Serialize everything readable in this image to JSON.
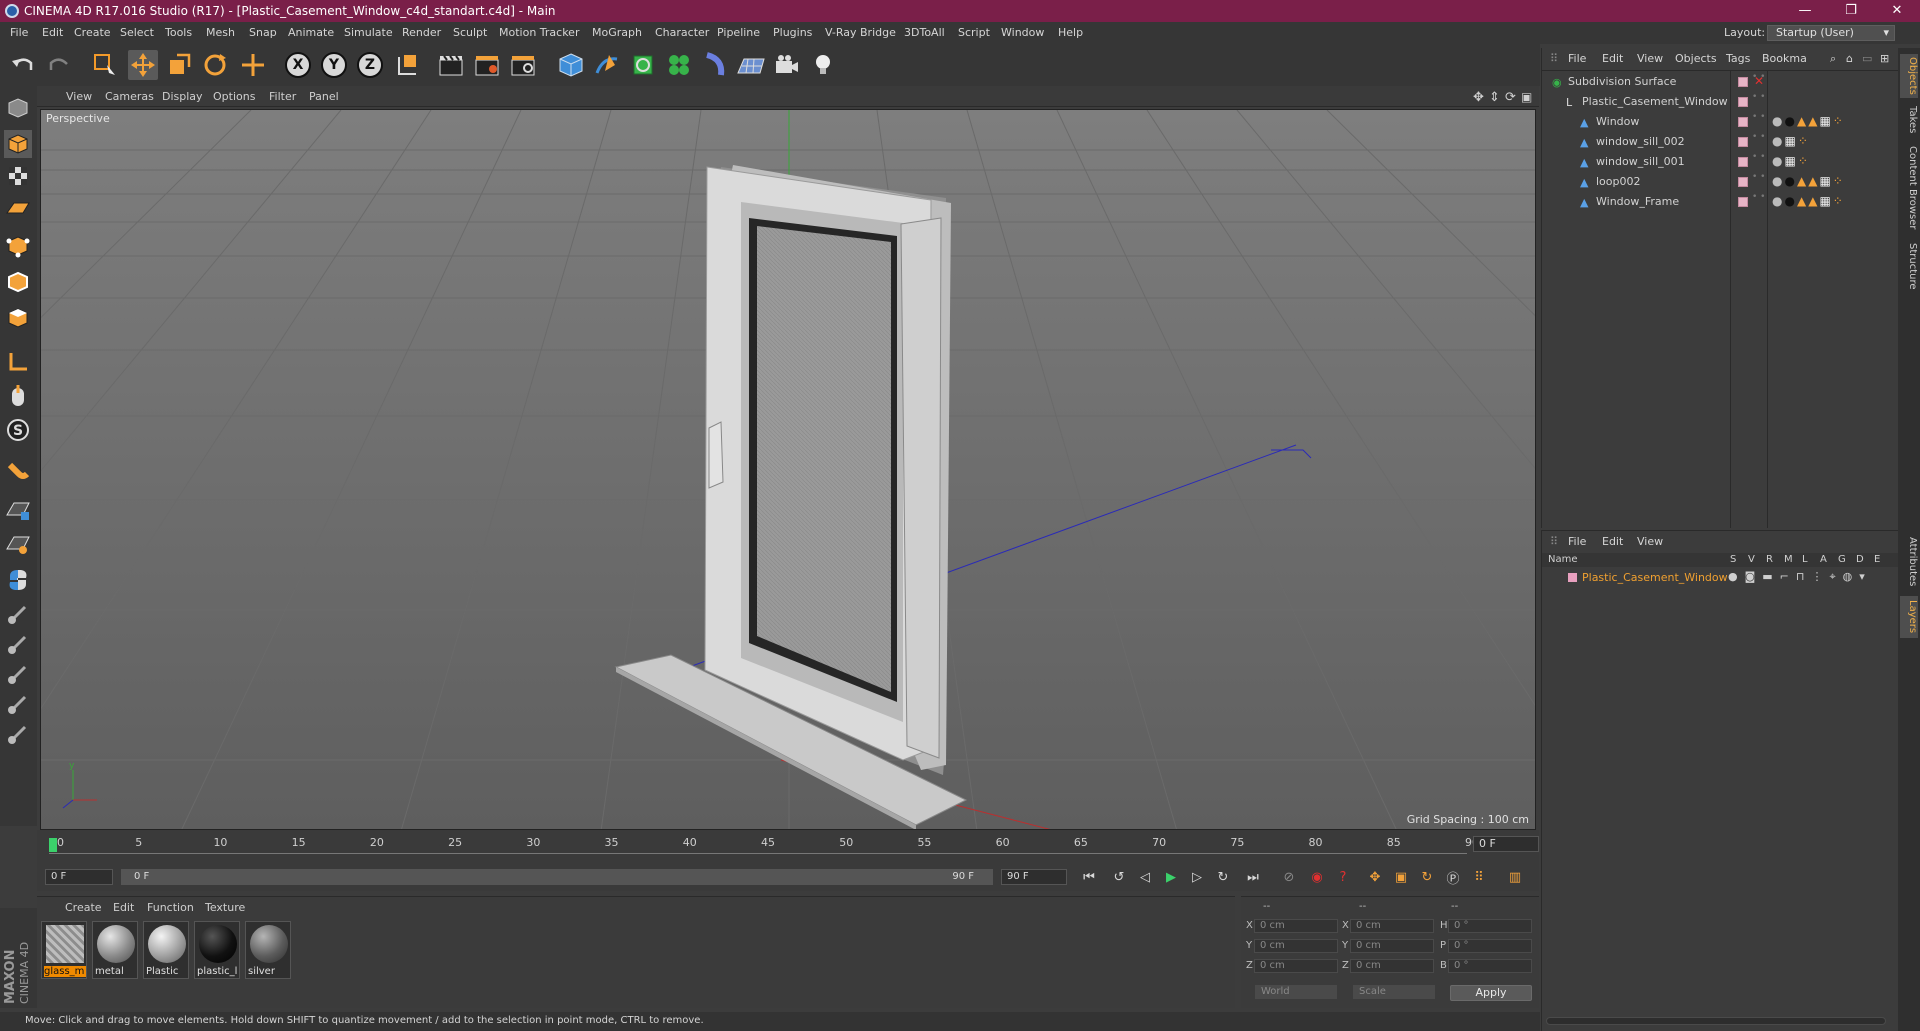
{
  "window": {
    "title": "CINEMA 4D R17.016 Studio (R17) - [Plastic_Casement_Window_c4d_standart.c4d] - Main",
    "controls": {
      "minimize": "—",
      "maximize": "❐",
      "close": "✕"
    }
  },
  "menubar": {
    "items": [
      "File",
      "Edit",
      "Create",
      "Select",
      "Tools",
      "Mesh",
      "Snap",
      "Animate",
      "Simulate",
      "Render",
      "Sculpt",
      "Motion Tracker",
      "MoGraph",
      "Character",
      "Pipeline",
      "Plugins",
      "V-Ray Bridge",
      "3DToAll",
      "Script",
      "Window",
      "Help"
    ],
    "layout_label": "Layout:",
    "layout_value": "Startup (User)"
  },
  "axes": {
    "x": "X",
    "y": "Y",
    "z": "Z"
  },
  "viewport": {
    "menu": [
      "View",
      "Cameras",
      "Display",
      "Options",
      "Filter",
      "Panel"
    ],
    "label": "Perspective",
    "grid_spacing": "Grid Spacing : 100 cm"
  },
  "timeline": {
    "ticks": [
      "0",
      "5",
      "10",
      "15",
      "20",
      "25",
      "30",
      "35",
      "40",
      "45",
      "50",
      "55",
      "60",
      "65",
      "70",
      "75",
      "80",
      "85",
      "90"
    ],
    "end_frame": "0 F"
  },
  "transport": {
    "current": "0 F",
    "range_start": "0 F",
    "range_end": "90 F",
    "max": "90 F"
  },
  "materials": {
    "menu": [
      "Create",
      "Edit",
      "Function",
      "Texture"
    ],
    "items": [
      {
        "name": "glass_m",
        "selected": true,
        "style": "glass"
      },
      {
        "name": "metal",
        "selected": false,
        "style": "grey"
      },
      {
        "name": "Plastic",
        "selected": false,
        "style": "light"
      },
      {
        "name": "plastic_l",
        "selected": false,
        "style": "black"
      },
      {
        "name": "silver",
        "selected": false,
        "style": "dark"
      }
    ]
  },
  "coordinates": {
    "headers": [
      "--",
      "--",
      "--"
    ],
    "rows": [
      {
        "a": "X",
        "av": "0 cm",
        "b": "X",
        "bv": "0 cm",
        "c": "H",
        "cv": "0 °"
      },
      {
        "a": "Y",
        "av": "0 cm",
        "b": "Y",
        "bv": "0 cm",
        "c": "P",
        "cv": "0 °"
      },
      {
        "a": "Z",
        "av": "0 cm",
        "b": "Z",
        "bv": "0 cm",
        "c": "B",
        "cv": "0 °"
      }
    ],
    "mode1": "World",
    "mode2": "Scale",
    "apply": "Apply"
  },
  "logo": {
    "text1": "MAXON",
    "text2": "CINEMA 4D"
  },
  "status": "Move: Click and drag to move elements. Hold down SHIFT to quantize movement / add to the selection in point mode, CTRL to remove.",
  "object_manager": {
    "menu": [
      "File",
      "Edit",
      "View",
      "Objects",
      "Tags",
      "Bookma"
    ],
    "objects": [
      {
        "name": "Subdivision Surface",
        "indent": 0,
        "kind": "subdiv"
      },
      {
        "name": "Plastic_Casement_Window",
        "indent": 1,
        "kind": "null"
      },
      {
        "name": "Window",
        "indent": 2,
        "kind": "poly"
      },
      {
        "name": "window_sill_002",
        "indent": 2,
        "kind": "poly"
      },
      {
        "name": "window_sill_001",
        "indent": 2,
        "kind": "poly"
      },
      {
        "name": "loop002",
        "indent": 2,
        "kind": "poly"
      },
      {
        "name": "Window_Frame",
        "indent": 2,
        "kind": "poly"
      }
    ]
  },
  "layer_manager": {
    "menu": [
      "File",
      "Edit",
      "View"
    ],
    "header_name": "Name",
    "columns": [
      "S",
      "V",
      "R",
      "M",
      "L",
      "A",
      "G",
      "D",
      "E"
    ],
    "layers": [
      {
        "name": "Plastic_Casement_Window",
        "color": "#e8a0bf"
      }
    ]
  },
  "right_tabs": [
    "Objects",
    "Takes",
    "Content Browser",
    "Structure",
    "Attributes",
    "Layers"
  ],
  "colors": {
    "titlebar": "#7a1f49",
    "accent": "#f0a030",
    "selected_material": "#f08a00"
  }
}
